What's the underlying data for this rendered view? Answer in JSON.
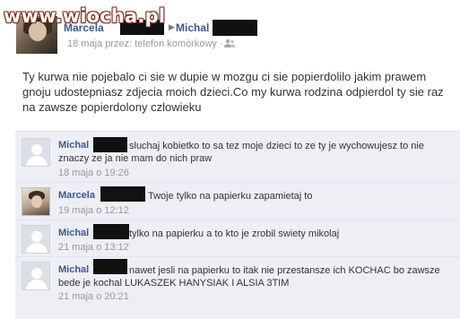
{
  "watermark": {
    "text": "www.wiocha.pl"
  },
  "post": {
    "author": "Marcela",
    "target": "Michal",
    "meta": "18 maja przez: telefon komórkowy ·",
    "privacy_icon": "people-icon",
    "body": "Ty kurwa nie pojebalo ci sie w dupie w mozgu ci sie popierdolilo jakim prawem gnoju udostepniasz zdjecia moich dzieci.Co my kurwa rodzina odpierdol ty sie raz na zawsze popierdolony czlowieku"
  },
  "comments": [
    {
      "author": "Michal",
      "line1": "sluchaj kobietko to sa tez moje dzieci to ze ty je wychowujesz to nie",
      "line2": "znaczy ze ja nie mam do nich praw",
      "time": "18 maja o 19:26"
    },
    {
      "author": "Marcela",
      "line1": "Twoje tylko na papierku zapamietaj to",
      "line2": "",
      "time": "19 maja o 12:12"
    },
    {
      "author": "Michal",
      "line1": "tylko na papierku a to kto je zrobil swiety mikolaj",
      "line2": "",
      "time": "21 maja o 13:12"
    },
    {
      "author": "Michal",
      "line1": "nawet jesli na papierku to itak nie przestansze ich KOCHAC bo zawsze",
      "line2": "bede je kochal LUKASZEK HANYSIAK I ALSIA 3TIM",
      "time": "21 maja o 20:21"
    }
  ],
  "colors": {
    "link": "#3b5998",
    "meta": "#999999",
    "comments_bg": "#edeff4"
  }
}
